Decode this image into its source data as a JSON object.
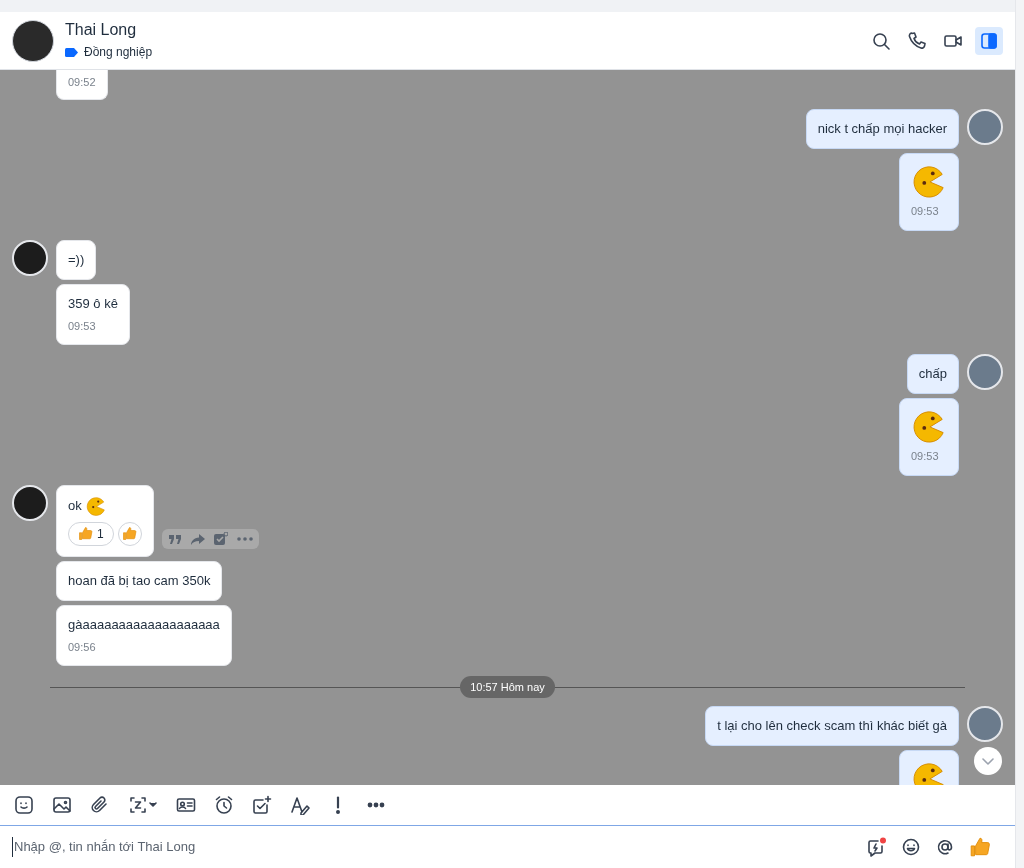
{
  "header": {
    "name": "Thai Long",
    "tag": "Đồng nghiệp",
    "actions": [
      {
        "kind": "search",
        "selected": false
      },
      {
        "kind": "call",
        "selected": false
      },
      {
        "kind": "video",
        "selected": false
      },
      {
        "kind": "panel",
        "selected": true
      }
    ]
  },
  "items": [
    {
      "kind": "group",
      "outgoing": false,
      "avatar": false,
      "bubbles": [
        {
          "kind": "text",
          "time": "09:52"
        }
      ]
    },
    {
      "kind": "group",
      "outgoing": true,
      "avatar": true,
      "bubbles": [
        {
          "kind": "text",
          "text": "nick t chấp mọi hacker"
        },
        {
          "kind": "sticker",
          "time": "09:53"
        }
      ]
    },
    {
      "kind": "group",
      "outgoing": false,
      "avatar": true,
      "bubbles": [
        {
          "kind": "text",
          "text": "=))"
        },
        {
          "kind": "text",
          "text": "359 ô kê",
          "time": "09:53"
        }
      ]
    },
    {
      "kind": "group",
      "outgoing": true,
      "avatar": true,
      "bubbles": [
        {
          "kind": "text",
          "text": "chấp"
        },
        {
          "kind": "sticker",
          "time": "09:53"
        }
      ]
    },
    {
      "kind": "group",
      "outgoing": false,
      "avatar": true,
      "bubbles": [
        {
          "kind": "text",
          "text": "ok",
          "inline_sticker": true,
          "hovered": true,
          "reactions": [
            {
              "count": "1"
            }
          ]
        },
        {
          "kind": "text",
          "text": "hoan đã bị tao cam 350k"
        },
        {
          "kind": "text",
          "text": "gàaaaaaaaaaaaaaaaaaaa",
          "time": "09:56"
        }
      ]
    },
    {
      "kind": "divider",
      "label": "10:57 Hôm nay"
    },
    {
      "kind": "group",
      "outgoing": true,
      "avatar": true,
      "bubbles": [
        {
          "kind": "text",
          "text": "t lại cho lên check scam thì khác biết gà"
        },
        {
          "kind": "sticker"
        }
      ]
    }
  ],
  "composer": {
    "placeholder": "Nhập @, tin nhắn tới Thai Long"
  }
}
